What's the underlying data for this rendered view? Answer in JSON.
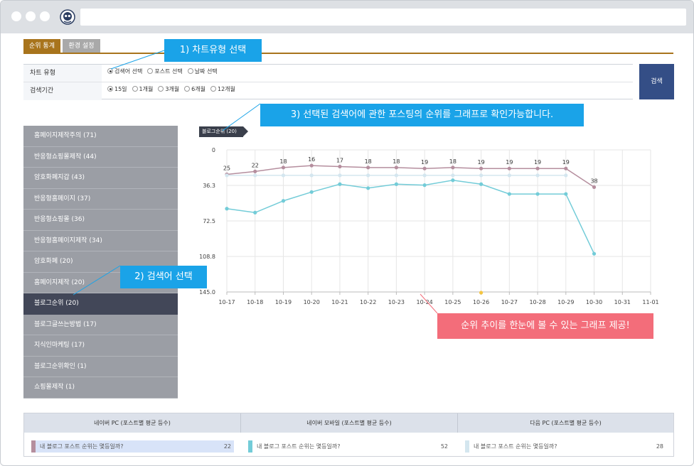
{
  "tabs": {
    "stats": "순위 통계",
    "settings": "환경 설정"
  },
  "form": {
    "row1": {
      "label": "차트 유형",
      "options": [
        {
          "label": "검색어 선택",
          "checked": true
        },
        {
          "label": "포스트 선택",
          "checked": false
        },
        {
          "label": "날짜 선택",
          "checked": false
        }
      ]
    },
    "row2": {
      "label": "검색기간",
      "options": [
        {
          "label": "15일",
          "checked": true
        },
        {
          "label": "1개월",
          "checked": false
        },
        {
          "label": "3개월",
          "checked": false
        },
        {
          "label": "6개월",
          "checked": false
        },
        {
          "label": "12개월",
          "checked": false
        }
      ]
    },
    "search_label": "검색"
  },
  "callouts": {
    "step1": "1) 차트유형 선택",
    "step2": "2) 검색어 선택",
    "step3": "3) 선택된 검색어에 관한 포스팅의 순위를 그래프로 확인가능합니다.",
    "note": "순위 추이를 한눈에 볼 수 있는 그래프 제공!"
  },
  "keywords": [
    {
      "label": "홈페이지제작주의 (71)",
      "active": false
    },
    {
      "label": "반응형쇼핑몰제작 (44)",
      "active": false
    },
    {
      "label": "암호화폐지갑 (43)",
      "active": false
    },
    {
      "label": "반응형홈페이지 (37)",
      "active": false
    },
    {
      "label": "반응형쇼핑몰 (36)",
      "active": false
    },
    {
      "label": "반응형홈페이지제작 (34)",
      "active": false
    },
    {
      "label": "암호화폐 (20)",
      "active": false
    },
    {
      "label": "홈페이지제작 (20)",
      "active": false
    },
    {
      "label": "블로그순위 (20)",
      "active": true
    },
    {
      "label": "블로그글쓰는방법 (17)",
      "active": false
    },
    {
      "label": "지식인마케팅 (17)",
      "active": false
    },
    {
      "label": "블로그순위확인 (1)",
      "active": false
    },
    {
      "label": "쇼핑몰제작 (1)",
      "active": false
    }
  ],
  "chart_tag": "블로그순위 (20)",
  "chart_data": {
    "type": "line",
    "x": [
      "10-17",
      "10-18",
      "10-19",
      "10-20",
      "10-21",
      "10-22",
      "10-23",
      "10-24",
      "10-25",
      "10-26",
      "10-27",
      "10-28",
      "10-29",
      "10-30",
      "10-31",
      "11-01"
    ],
    "yticks": [
      "0",
      "36.3",
      "72.5",
      "108.8",
      "145.0"
    ],
    "ylim": [
      0,
      145
    ],
    "y_inverted": true,
    "grid": true,
    "series": [
      {
        "color": "#b58e9e",
        "labeled": true,
        "values": [
          25,
          22,
          18,
          16,
          17,
          18,
          18,
          19,
          18,
          19,
          19,
          19,
          19,
          38,
          null,
          null
        ]
      },
      {
        "color": "#d4e6ef",
        "labeled": false,
        "values": [
          26,
          26,
          26,
          26,
          26,
          26,
          26,
          26,
          26,
          26,
          26,
          26,
          26,
          null,
          null,
          null
        ]
      },
      {
        "color": "#73ccd8",
        "labeled": false,
        "values": [
          60,
          64,
          52,
          43,
          35,
          39,
          35,
          36,
          31,
          35,
          45,
          45,
          45,
          106,
          null,
          null
        ]
      }
    ],
    "marker": {
      "x": "10-26",
      "color": "#f4c542"
    }
  },
  "summary": [
    {
      "header": "네이버 PC (포스트별 평균 등수)",
      "text": "내 블로그 포스트 순위는 몇등일까?",
      "value": "22",
      "color": "#b58e9e",
      "row_bg": "#d8e3f8"
    },
    {
      "header": "네이버 모바일 (포스트별 평균 등수)",
      "text": "내 블로그 포스트 순위는 몇등일까?",
      "value": "52",
      "color": "#73ccd8",
      "row_bg": "#ffffff"
    },
    {
      "header": "다음 PC (포스트별 평균 등수)",
      "text": "내 블로그 포스트 순위는 몇등일까?",
      "value": "28",
      "color": "#d4e6ef",
      "row_bg": "#ffffff"
    }
  ]
}
